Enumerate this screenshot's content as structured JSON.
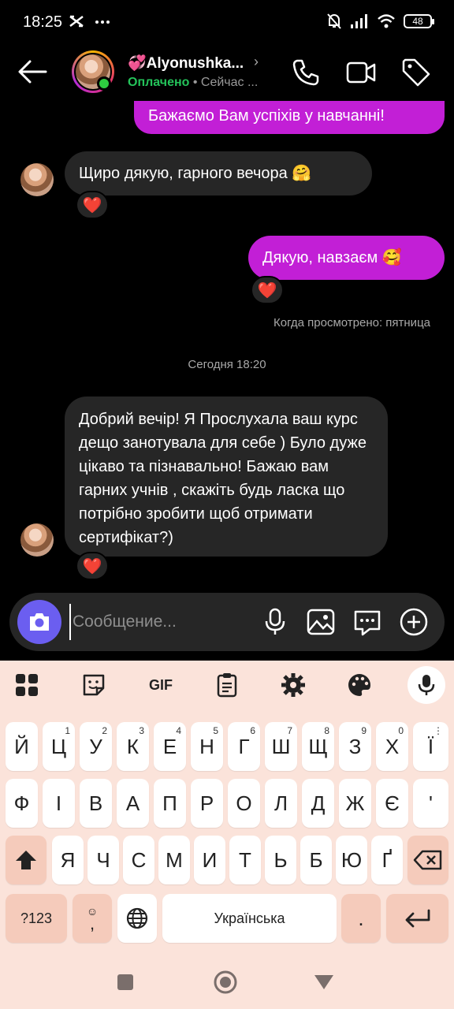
{
  "status": {
    "time": "18:25",
    "battery": "48"
  },
  "header": {
    "name": "💞Alyonushka...",
    "status_paid": "Оплачено",
    "status_rest": " • Сейчас ..."
  },
  "messages": [
    {
      "text": "Бажаємо Вам успіхів у навчанні!",
      "dir": "out"
    },
    {
      "text": "Щиро дякую, гарного вечора 🤗",
      "dir": "in",
      "reaction": "❤️"
    },
    {
      "text": "Дякую, навзаєм 🥰",
      "dir": "out",
      "reaction": "❤️"
    },
    {
      "text": "Добрий вечір! Я Прослухала ваш курс дещо занотувала для себе ) Було дуже цікаво та пізнавально! Бажаю вам гарних учнів , скажіть будь ласка що потрібно зробити щоб отримати сертифікат?)",
      "dir": "in",
      "reaction": "❤️"
    }
  ],
  "seen_text": "Когда просмотрено: пятница",
  "day_separator": "Сегодня 18:20",
  "composer": {
    "placeholder": "Сообщение..."
  },
  "keyboard": {
    "toolbar_gif": "GIF",
    "row1": [
      {
        "k": "Й",
        "n": ""
      },
      {
        "k": "Ц",
        "n": "1"
      },
      {
        "k": "У",
        "n": "2"
      },
      {
        "k": "К",
        "n": "3"
      },
      {
        "k": "Е",
        "n": "4"
      },
      {
        "k": "Н",
        "n": "5"
      },
      {
        "k": "Г",
        "n": "6"
      },
      {
        "k": "Ш",
        "n": "7"
      },
      {
        "k": "Щ",
        "n": "8"
      },
      {
        "k": "З",
        "n": "9"
      },
      {
        "k": "Х",
        "n": "0"
      },
      {
        "k": "Ї",
        "n": ""
      }
    ],
    "row2": [
      "Ф",
      "І",
      "В",
      "А",
      "П",
      "Р",
      "О",
      "Л",
      "Д",
      "Ж",
      "Є",
      "'"
    ],
    "row3": [
      "Я",
      "Ч",
      "С",
      "М",
      "И",
      "Т",
      "Ь",
      "Б",
      "Ю",
      "Ґ"
    ],
    "sym_key": "?123",
    "emoji_comma": ",",
    "space_label": "Українська",
    "period": "."
  }
}
